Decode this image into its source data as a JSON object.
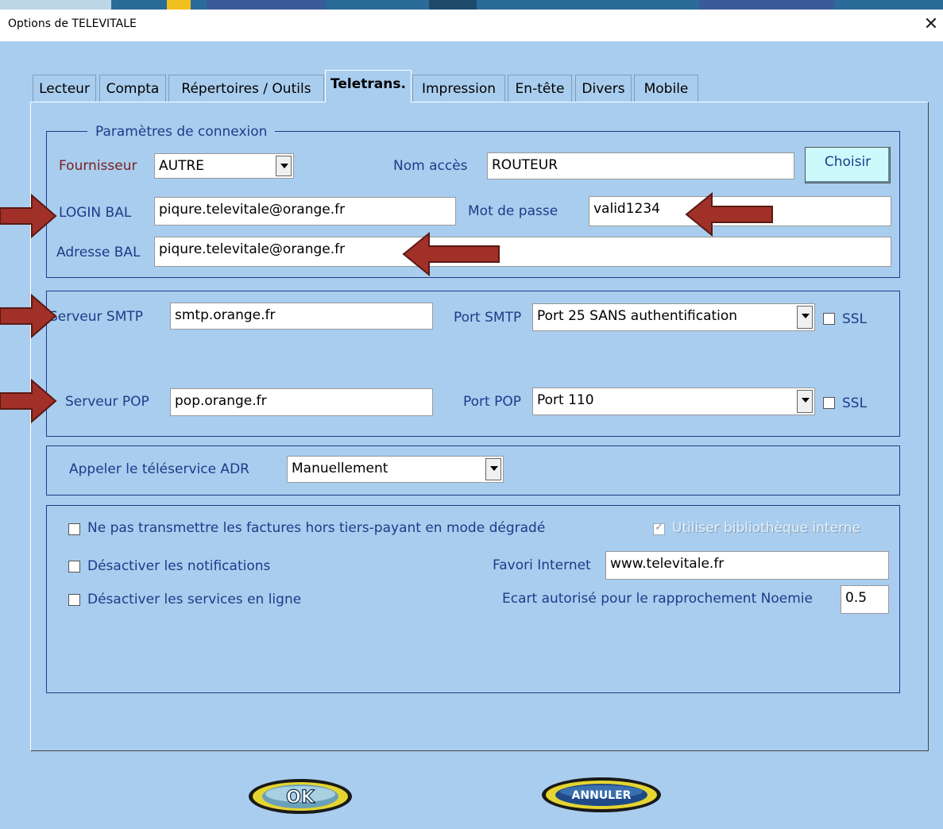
{
  "window": {
    "title": "Options de TELEVITALE"
  },
  "tabs": [
    {
      "label": "Lecteur"
    },
    {
      "label": "Compta"
    },
    {
      "label": "Répertoires / Outils"
    },
    {
      "label": "Teletrans."
    },
    {
      "label": "Impression"
    },
    {
      "label": "En-tête"
    },
    {
      "label": "Divers"
    },
    {
      "label": "Mobile"
    }
  ],
  "active_tab": "Teletrans.",
  "connexion": {
    "legend": "Paramètres de connexion",
    "fournisseur_label": "Fournisseur",
    "fournisseur_value": "AUTRE",
    "nom_acces_label": "Nom accès",
    "nom_acces_value": "ROUTEUR",
    "choisir_label": "Choisir",
    "login_label": "LOGIN BAL",
    "login_value": "piqure.televitale@orange.fr",
    "password_label": "Mot de passe",
    "password_value": "valid1234",
    "adresse_label": "Adresse BAL",
    "adresse_value": "piqure.televitale@orange.fr"
  },
  "servers": {
    "smtp_label": "Serveur SMTP",
    "smtp_value": "smtp.orange.fr",
    "port_smtp_label": "Port SMTP",
    "port_smtp_value": "Port 25 SANS authentification",
    "ssl_label": "SSL",
    "pop_label": "Serveur POP",
    "pop_value": "pop.orange.fr",
    "port_pop_label": "Port POP",
    "port_pop_value": "Port 110",
    "ssl_pop_label": "SSL"
  },
  "adr": {
    "label": "Appeler le téléservice ADR",
    "value": "Manuellement"
  },
  "options": {
    "no_transmit_label": "Ne pas transmettre les factures hors tiers-payant en mode dégradé",
    "internal_lib_label": "Utiliser bibliothèque interne",
    "notifications_label": "Désactiver les notifications",
    "favori_label": "Favori Internet",
    "favori_value": "www.televitale.fr",
    "services_label": "Désactiver les services en ligne",
    "ecart_label": "Ecart autorisé pour le rapprochement Noemie",
    "ecart_value": "0.5"
  },
  "buttons": {
    "ok": "OK",
    "cancel": "ANNULER"
  },
  "colors": {
    "background": "#a9cdee",
    "label_blue": "#1f3a8a",
    "fournisseur_red": "#7a1f1f",
    "arrow": "#a03028",
    "choisir_bg": "#ccfafc"
  }
}
